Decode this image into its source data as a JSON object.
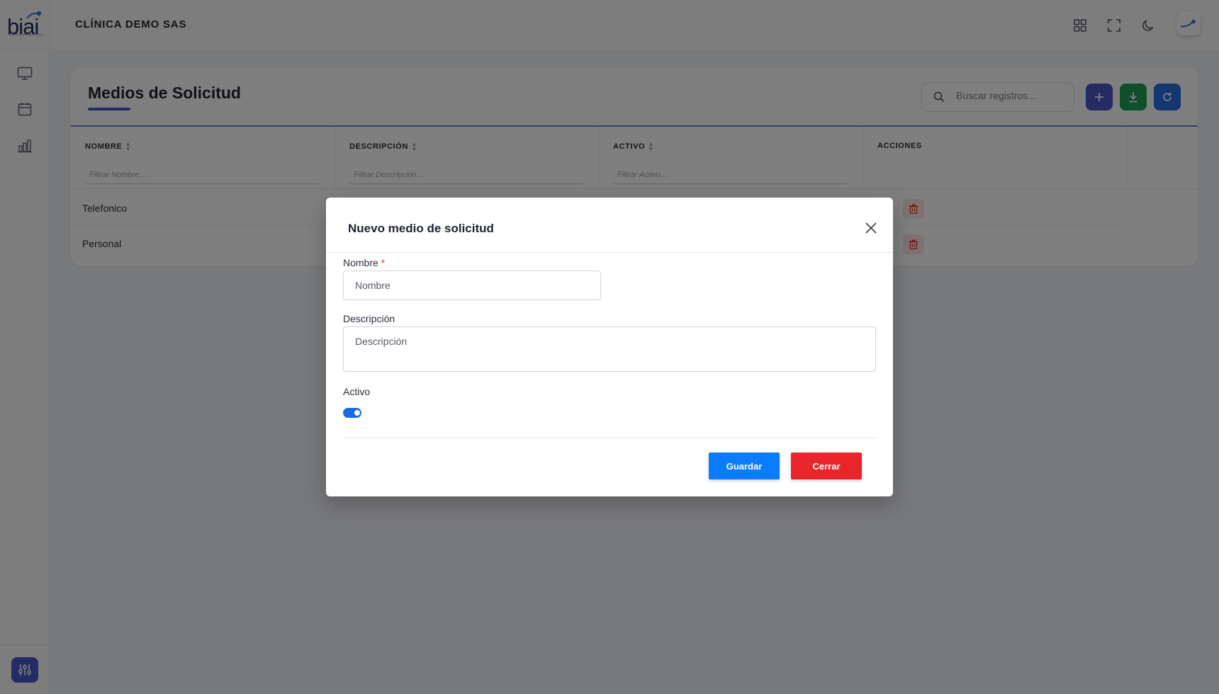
{
  "app": {
    "logo_text": "biai",
    "company": "CLÍNICA DEMO SAS"
  },
  "sidebar": {
    "items": [
      {
        "icon": "monitor-icon"
      },
      {
        "icon": "calendar-icon"
      },
      {
        "icon": "bar-chart-icon"
      }
    ],
    "settings_icon": "sliders-icon"
  },
  "header": {
    "icons": [
      "grid-icon",
      "fullscreen-icon",
      "moon-icon",
      "user-avatar"
    ]
  },
  "page": {
    "title": "Medios de Solicitud",
    "search": {
      "placeholder": "Buscar registros..."
    },
    "toolbar": [
      {
        "name": "add-button",
        "icon": "plus-icon",
        "color": "#4a57c7"
      },
      {
        "name": "download-button",
        "icon": "download-icon",
        "color": "#1e9e57"
      },
      {
        "name": "refresh-button",
        "icon": "refresh-icon",
        "color": "#2a6ee0"
      }
    ]
  },
  "table": {
    "columns": [
      {
        "label": "NOMBRE",
        "filter_placeholder": "Filtrar Nombre..."
      },
      {
        "label": "DESCRIPCIÓN",
        "filter_placeholder": "Filtrar Descripción..."
      },
      {
        "label": "ACTIVO",
        "filter_placeholder": "Filtrar Activo..."
      },
      {
        "label": "ACCIONES"
      }
    ],
    "rows": [
      {
        "nombre": "Telefonico"
      },
      {
        "nombre": "Personal"
      }
    ]
  },
  "modal": {
    "title": "Nuevo medio de solicitud",
    "nombre_label": "Nombre",
    "nombre_required": "*",
    "nombre_placeholder": "Nombre",
    "descripcion_label": "Descripción",
    "descripcion_placeholder": "Descripción",
    "activo_label": "Activo",
    "activo_value": true,
    "save_label": "Guardar",
    "close_label": "Cerrar",
    "colors": {
      "save": "#0a7cff",
      "close": "#e8262a",
      "toggle": "#1a6be0"
    }
  }
}
